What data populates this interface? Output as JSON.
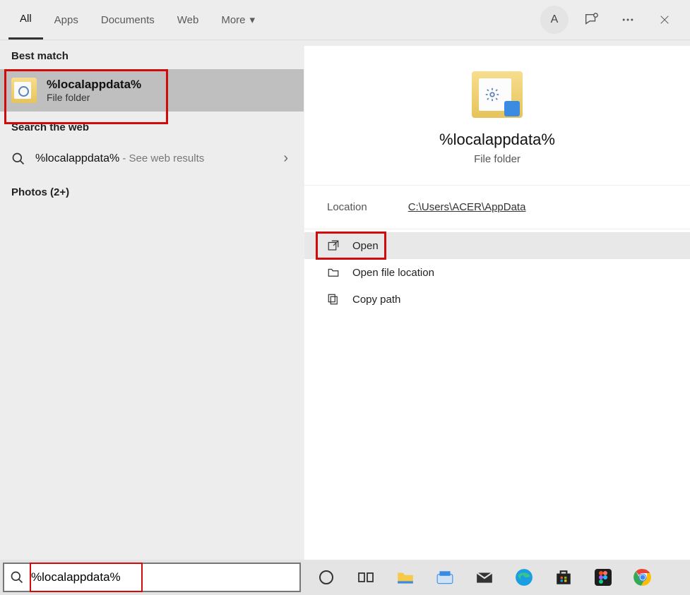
{
  "header": {
    "tabs": {
      "all": "All",
      "apps": "Apps",
      "documents": "Documents",
      "web": "Web",
      "more": "More"
    },
    "avatar_initial": "A"
  },
  "left": {
    "best_match_label": "Best match",
    "best_match": {
      "title": "%localappdata%",
      "subtitle": "File folder"
    },
    "search_web_label": "Search the web",
    "web_query": "%localappdata%",
    "web_suffix": " - See web results",
    "photos_label": "Photos (2+)"
  },
  "right": {
    "title": "%localappdata%",
    "subtitle": "File folder",
    "location_label": "Location",
    "location_path": "C:\\Users\\ACER\\AppData",
    "actions": {
      "open": "Open",
      "open_loc": "Open file location",
      "copy_path": "Copy path"
    }
  },
  "search": {
    "value": "%localappdata%"
  }
}
